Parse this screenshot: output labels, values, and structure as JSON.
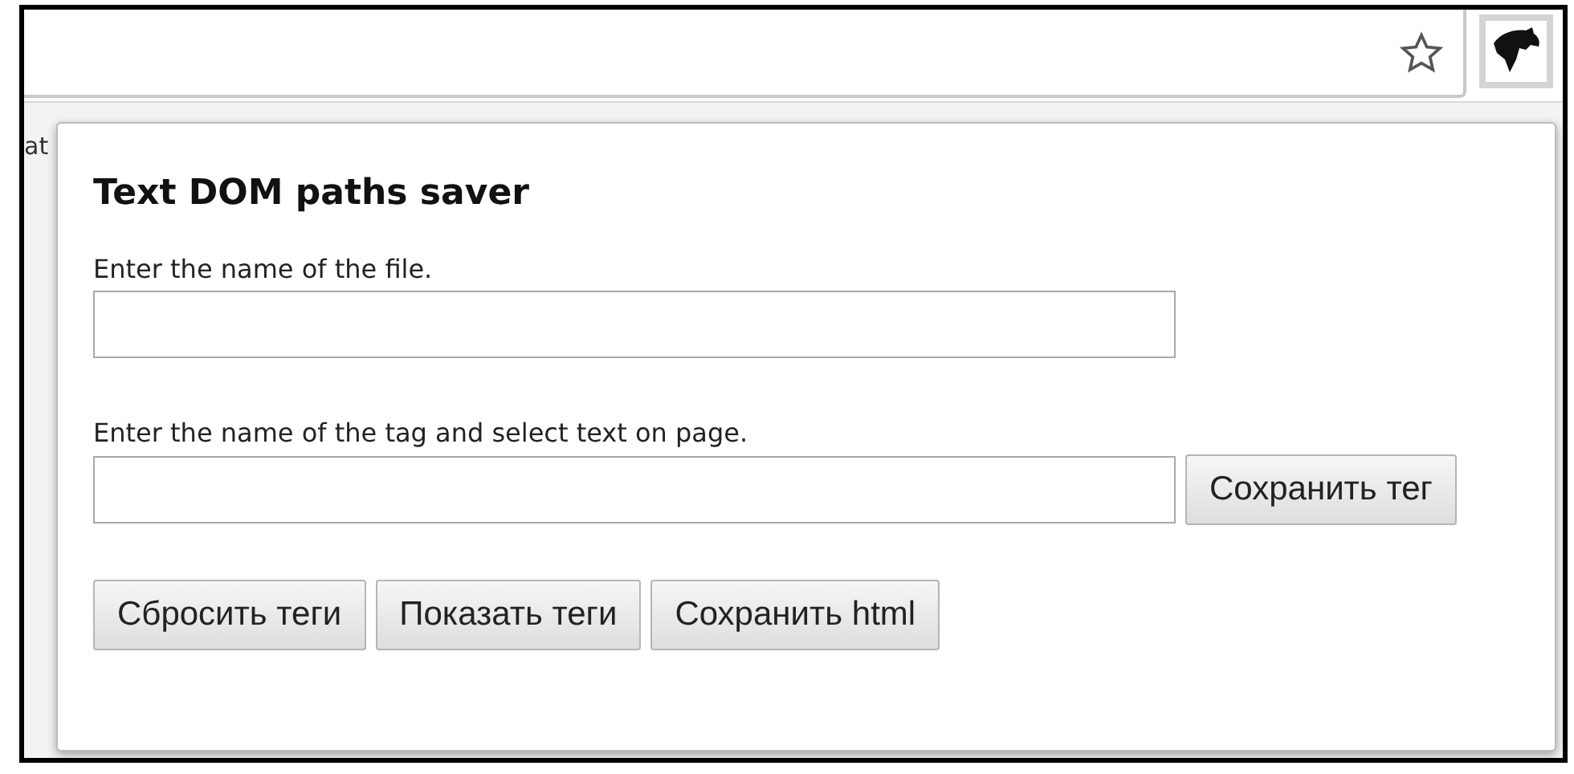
{
  "page_fragment": "at",
  "popup": {
    "title": "Text DOM paths saver",
    "fields": [
      {
        "label": "Enter the name of the file."
      },
      {
        "label": "Enter the name of the tag and select text on page.",
        "button": "Сохранить тег"
      }
    ],
    "buttons": [
      "Сбросить теги",
      "Показать теги",
      "Сохранить html"
    ]
  }
}
